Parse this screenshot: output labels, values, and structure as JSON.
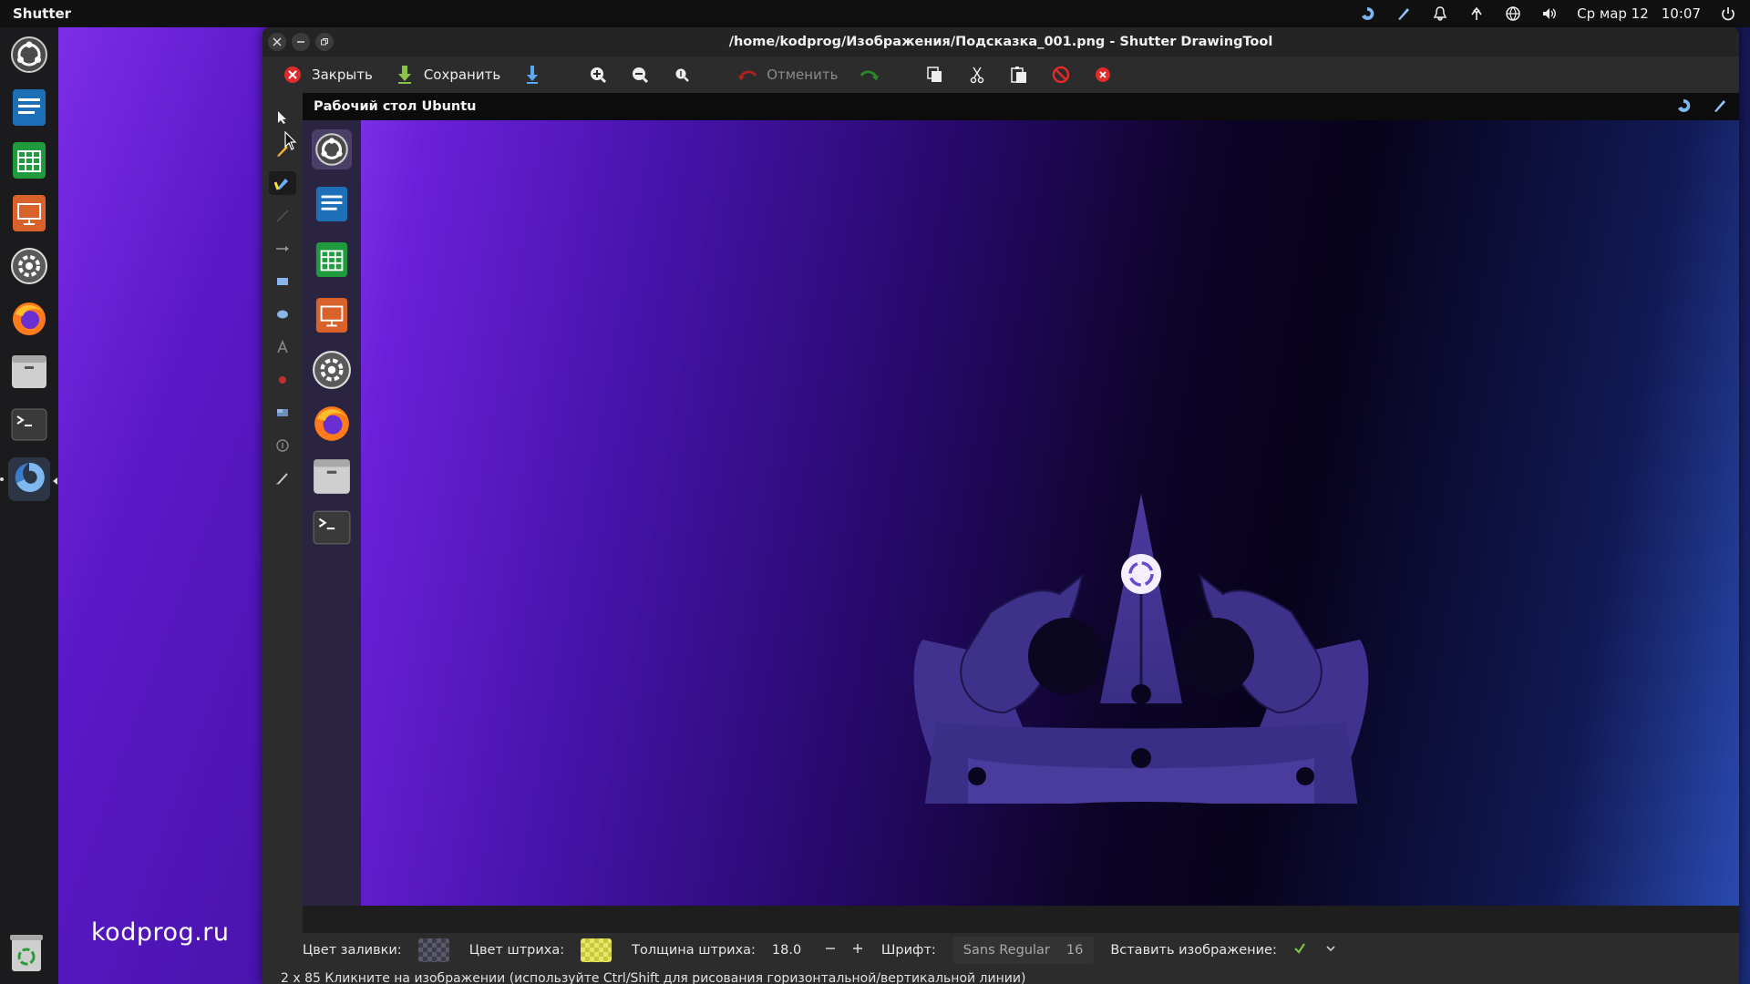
{
  "topbar": {
    "app_name": "Shutter",
    "date": "Ср мар 12",
    "time": "10:07"
  },
  "desktop": {
    "watermark": "kodprog.ru"
  },
  "window": {
    "title": "/home/kodprog/Изображения/Подсказка_001.png - Shutter DrawingTool",
    "toolbar": {
      "close_label": "Закрыть",
      "save_label": "Сохранить",
      "undo_label": "Отменить"
    },
    "canvas": {
      "header": "Рабочий стол Ubuntu"
    },
    "options": {
      "fill_color_label": "Цвет заливки:",
      "stroke_color_label": "Цвет штриха:",
      "stroke_width_label": "Толщина штриха:",
      "stroke_width_value": "18.0",
      "font_label": "Шрифт:",
      "font_name": "Sans Regular",
      "font_size": "16",
      "insert_image_label": "Вставить изображение:"
    },
    "status": "2 x 85 Кликните на изображении (используйте Ctrl/Shift для рисования горизонтальной/вертикальной линии)"
  },
  "colors": {
    "stroke_swatch": "#d6d64a",
    "fill_swatch": "#4a4a5a",
    "accent_red": "#e02b2b"
  },
  "icons": {
    "dock": [
      "ubuntu-logo-icon",
      "writer-icon",
      "calc-icon",
      "impress-icon",
      "settings-icon",
      "firefox-icon",
      "files-icon",
      "terminal-icon",
      "shutter-icon",
      "trash-icon"
    ],
    "tools": [
      "select-icon",
      "pencil-icon",
      "highlighter-icon",
      "line-icon",
      "arrow-icon",
      "rectangle-icon",
      "ellipse-icon",
      "text-icon",
      "censor-icon",
      "pixelize-icon",
      "number-icon",
      "clear-icon"
    ]
  }
}
